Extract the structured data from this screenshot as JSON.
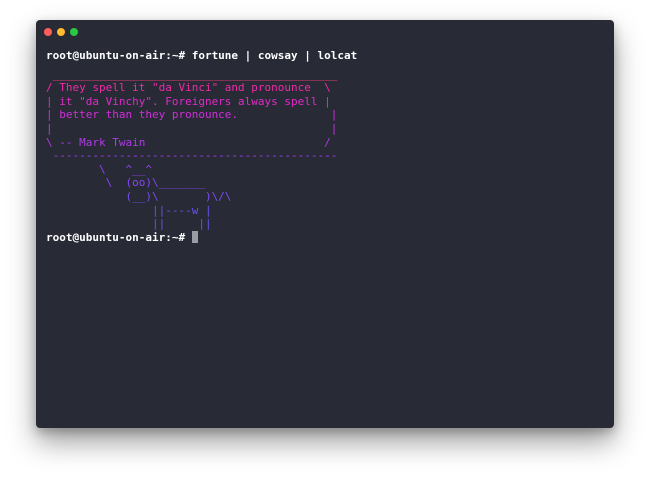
{
  "window": {
    "traffic_lights": [
      {
        "name": "close",
        "color": "#ff5f57"
      },
      {
        "name": "minimize",
        "color": "#febc2e"
      },
      {
        "name": "zoom",
        "color": "#28c840"
      }
    ],
    "background_color": "#282a36"
  },
  "terminal": {
    "command_line": "root@ubuntu-on-air:~# fortune | cowsay | lolcat",
    "output": [
      {
        "text": " ___________________________________________",
        "color": "#ff3c7a"
      },
      {
        "text": "/ They spell it \"da Vinci\" and pronounce  \\",
        "color": "#ee2ca8"
      },
      {
        "text": "| it \"da Vinchy\". Foreigners always spell |",
        "color": "#e02cc8"
      },
      {
        "text": "| better than they pronounce.              |",
        "color": "#d12fda"
      },
      {
        "text": "|                                          |",
        "color": "#c234e2"
      },
      {
        "text": "\\ -- Mark Twain                           /",
        "color": "#b03ae8"
      },
      {
        "text": " -------------------------------------------",
        "color": "#a03ff0"
      },
      {
        "text": "        \\   ^__^",
        "color": "#9442f0"
      },
      {
        "text": "         \\  (oo)\\_______",
        "color": "#8746f0"
      },
      {
        "text": "            (__)\\       )\\/\\",
        "color": "#7b4cf0"
      },
      {
        "text": "                ||----w |",
        "color": "#6c52ee"
      },
      {
        "text": "                ||     ||",
        "color": "#5f58ea"
      }
    ],
    "prompt": "root@ubuntu-on-air:~#",
    "text_color": "#ffffff",
    "cursor_color": "#9a9ca4"
  }
}
